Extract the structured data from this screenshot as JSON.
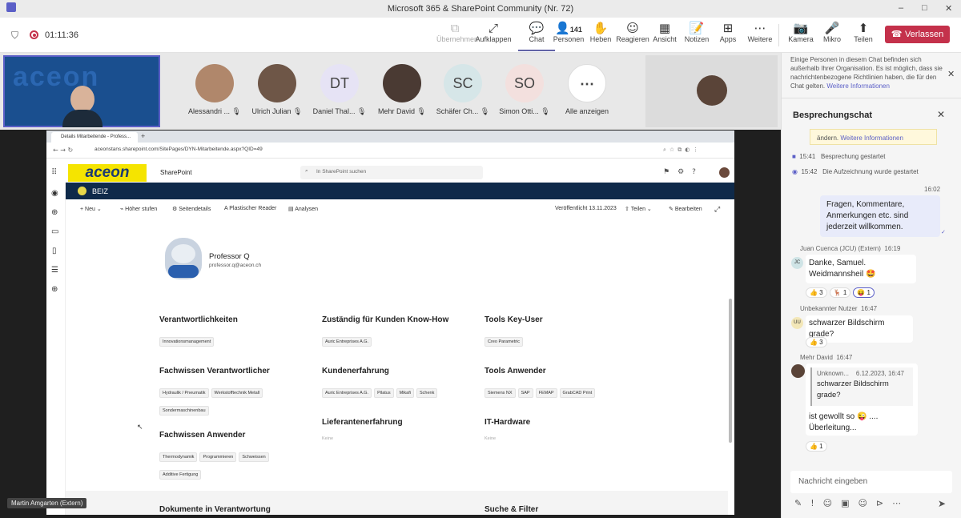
{
  "window": {
    "title": "Microsoft 365 & SharePoint Community (Nr. 72)",
    "minimize": "–",
    "maximize": "□",
    "close": "✕"
  },
  "meeting": {
    "timer": "01:11:36"
  },
  "toolbar": {
    "items": [
      {
        "label": "Übernehmen",
        "icon": "⧉"
      },
      {
        "label": "Aufklappen",
        "icon": "⤢"
      },
      {
        "label": "Chat",
        "icon": "💬"
      },
      {
        "label": "Personen",
        "icon": "👤",
        "count": "141"
      },
      {
        "label": "Heben",
        "icon": "✋"
      },
      {
        "label": "Reagieren",
        "icon": "☺"
      },
      {
        "label": "Ansicht",
        "icon": "▦"
      },
      {
        "label": "Notizen",
        "icon": "📝"
      },
      {
        "label": "Apps",
        "icon": "⊞"
      },
      {
        "label": "Weitere",
        "icon": "⋯"
      },
      {
        "label": "Kamera",
        "icon": "📷"
      },
      {
        "label": "Mikro",
        "icon": "🎤"
      },
      {
        "label": "Teilen",
        "icon": "⬆"
      }
    ],
    "leave": "Verlassen"
  },
  "participants": [
    {
      "name": "Alessandri ...",
      "initials": "",
      "photo": true
    },
    {
      "name": "Ulrich Julian",
      "initials": "",
      "photo": true
    },
    {
      "name": "Daniel Thal...",
      "initials": "DT",
      "photo": false,
      "color": "#e6e3f5"
    },
    {
      "name": "Mehr David",
      "initials": "",
      "photo": true
    },
    {
      "name": "Schäfer Ch...",
      "initials": "SC",
      "photo": false,
      "color": "#d6e6e8"
    },
    {
      "name": "Simon Otti...",
      "initials": "SO",
      "photo": false,
      "color": "#f3e0de"
    },
    {
      "name": "Alle anzeigen",
      "initials": "⋯",
      "photo": false,
      "color": "#ffffff"
    }
  ],
  "presenter": {
    "name": "Martin Amgarten (Extern)"
  },
  "browser": {
    "tab": "Details Mitarbeitende - Profess...",
    "url": "aceonstans.sharepoint.com/SitePages/DYN-Mitarbeitende.aspx?QID=49",
    "logo": "aceon",
    "app": "SharePoint",
    "search": "In SharePoint suchen",
    "site": "BEIZ",
    "cmd": {
      "new": "Neu",
      "promote": "Höher stufen",
      "details": "Seitendetails",
      "reader": "Plastischer Reader",
      "analytics": "Analysen",
      "published": "Veröffentlicht 13.11.2023",
      "share": "Teilen",
      "edit": "Bearbeiten"
    },
    "profile": {
      "name": "Professor Q",
      "email": "professor.q@aceon.ch"
    },
    "sections": [
      {
        "title": "Verantwortlichkeiten",
        "chips": [
          "Innovationsmanagement"
        ]
      },
      {
        "title": "Zuständig für Kunden Know-How",
        "chips": [
          "Auric Entreprises A.G."
        ]
      },
      {
        "title": "Tools Key-User",
        "chips": [
          "Creo Parametric"
        ]
      },
      {
        "title": "Fachwissen Verantwortlicher",
        "chips": [
          "Hydraulik / Pneumatik",
          "Werkstofftechnik Metall",
          "Sondermaschinenbau"
        ]
      },
      {
        "title": "Kundenerfahrung",
        "chips": [
          "Auric Entreprises A.G.",
          "Pilatus",
          "Mikafi",
          "Schenk"
        ]
      },
      {
        "title": "Tools Anwender",
        "chips": [
          "Siemens NX",
          "SAP",
          "FEMAP",
          "GrabCAD Print"
        ]
      },
      {
        "title": "Fachwissen Anwender",
        "chips": [
          "Thermodynamik",
          "Programmieren",
          "Schweissen",
          "Additive Fertigung"
        ]
      },
      {
        "title": "Lieferantenerfahrung",
        "chips": [],
        "empty": "Keine"
      },
      {
        "title": "IT-Hardware",
        "chips": [],
        "empty": "Keine"
      },
      {
        "title": "Dokumente in Verantwortung",
        "chips": []
      },
      {
        "title": "Suche & Filter",
        "chips": []
      }
    ]
  },
  "chat": {
    "notice": "Einige Personen in diesem Chat befinden sich außerhalb Ihrer Organisation. Es ist möglich, dass sie nachrichtenbezogene Richtlinien haben, die für den Chat gelten.",
    "notice_link": "Weitere Informationen",
    "title": "Besprechungschat",
    "banner": "ändern.",
    "banner_link": "Weitere Informationen",
    "events": [
      {
        "time": "15:41",
        "text": "Besprechung gestartet"
      },
      {
        "time": "15:42",
        "text": "Die Aufzeichnung wurde gestartet"
      }
    ],
    "own_time": "16:02",
    "own_msg": "Fragen, Kommentare, Anmerkungen etc. sind jederzeit willkommen.",
    "m1": {
      "author": "Juan Cuenca (JCU) (Extern)",
      "time": "16:19",
      "initials": "JC",
      "text1": "Danke, Samuel.",
      "text2": "Weidmannsheil 🤩",
      "r1": "👍 3",
      "r2": "🦌 1",
      "r3": "😝 1"
    },
    "m2": {
      "author": "Unbekannter Nutzer",
      "time": "16:47",
      "initials": "UU",
      "text": "schwarzer Bildschirm grade?",
      "r1": "👍 3"
    },
    "m3": {
      "author": "Mehr David",
      "time": "16:47",
      "quote_author": "Unknown...",
      "quote_time": "6.12.2023, 16:47",
      "quote_text": "schwarzer Bildschirm grade?",
      "text1": "ist gewollt so 😜 ....",
      "text2": "Überleitung...",
      "r1": "👍 1"
    },
    "input_placeholder": "Nachricht eingeben"
  }
}
